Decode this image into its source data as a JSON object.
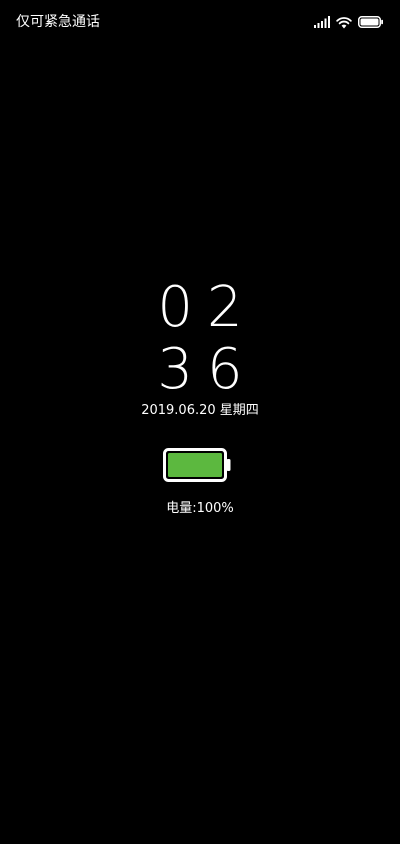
{
  "status_bar": {
    "carrier_text": "仅可紧急通话",
    "icons": [
      "signal-icon",
      "wifi-icon",
      "battery-icon"
    ]
  },
  "lockscreen": {
    "time_hours": "02",
    "time_minutes": "36",
    "date": "2019.06.20 星期四",
    "battery_label": "电量:100%",
    "battery_level": 1.0
  },
  "colors": {
    "background": "#000000",
    "text": "#ffffff",
    "battery_fill": "#5cb83f"
  }
}
